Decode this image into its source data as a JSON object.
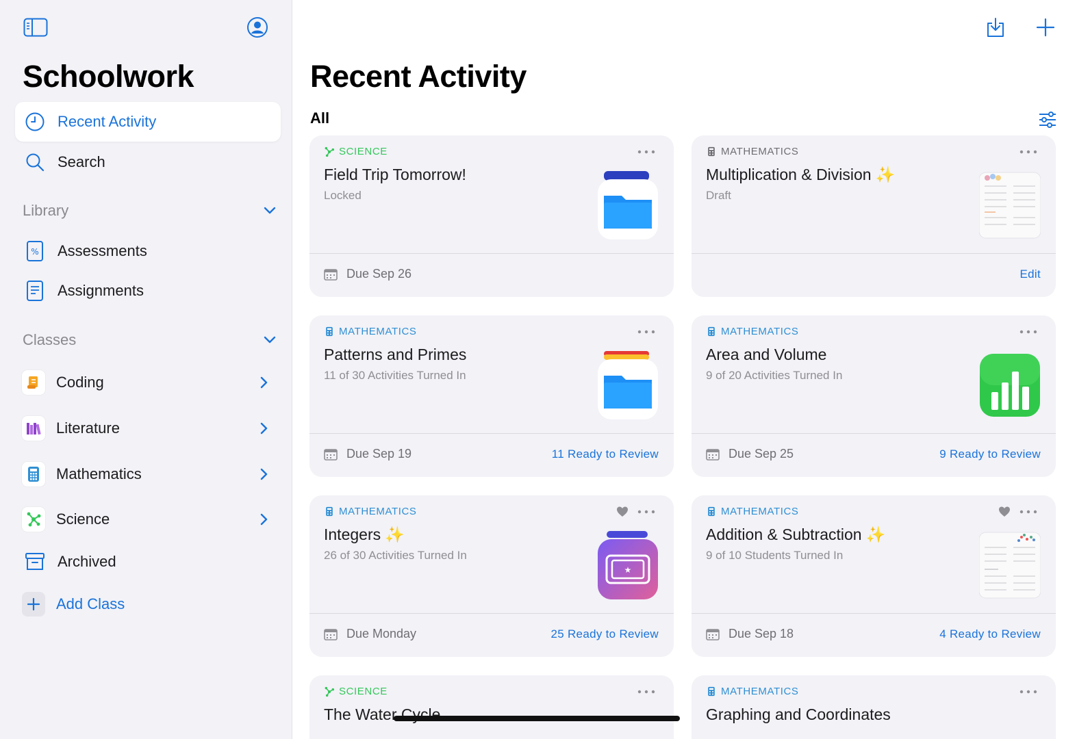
{
  "sidebar": {
    "title": "Schoolwork",
    "nav": [
      {
        "label": "Recent Activity",
        "icon": "clock-icon"
      },
      {
        "label": "Search",
        "icon": "magnifier-icon"
      }
    ],
    "library": {
      "header": "Library",
      "items": [
        {
          "label": "Assessments",
          "icon": "percent-doc-icon"
        },
        {
          "label": "Assignments",
          "icon": "doc-icon"
        }
      ]
    },
    "classes": {
      "header": "Classes",
      "items": [
        {
          "label": "Coding",
          "icon": "scroll-icon"
        },
        {
          "label": "Literature",
          "icon": "books-icon"
        },
        {
          "label": "Mathematics",
          "icon": "calculator-icon"
        },
        {
          "label": "Science",
          "icon": "molecule-icon"
        }
      ]
    },
    "archived": "Archived",
    "add_class": "Add Class"
  },
  "main": {
    "title": "Recent Activity",
    "filter": "All",
    "cards": [
      {
        "subject": "SCIENCE",
        "title": "Field Trip Tomorrow!",
        "sparkle": "",
        "subtitle": "Locked",
        "due": "Due Sep 26",
        "action": "",
        "thumb": "files-app-icon"
      },
      {
        "subject": "MATHEMATICS",
        "title": "Multiplication & Division",
        "sparkle": "✨",
        "subtitle": "Draft",
        "due": "",
        "action": "Edit",
        "thumb": "worksheet-thumbnail"
      },
      {
        "subject": "MATHEMATICS",
        "title": "Patterns and Primes",
        "sparkle": "",
        "subtitle": "11 of 30 Activities Turned In",
        "due": "Due Sep 19",
        "action": "11 Ready to Review",
        "thumb": "files-app-icon"
      },
      {
        "subject": "MATHEMATICS",
        "title": "Area and Volume",
        "sparkle": "",
        "subtitle": "9 of 20 Activities Turned In",
        "due": "Due Sep 25",
        "action": "9 Ready to Review",
        "thumb": "numbers-app-icon"
      },
      {
        "subject": "MATHEMATICS",
        "title": "Integers",
        "sparkle": "✨",
        "subtitle": "26 of 30 Activities Turned In",
        "due": "Due Monday",
        "action": "25 Ready to Review",
        "thumb": "activity-app-icon"
      },
      {
        "subject": "MATHEMATICS",
        "title": "Addition & Subtraction",
        "sparkle": "✨",
        "subtitle": "9 of 10 Students Turned In",
        "due": "Due Sep 18",
        "action": "4 Ready to Review",
        "thumb": "worksheet-thumbnail"
      },
      {
        "subject": "SCIENCE",
        "title": "The Water Cycle",
        "sparkle": "",
        "subtitle": "",
        "due": "",
        "action": "",
        "thumb": ""
      },
      {
        "subject": "MATHEMATICS",
        "title": "Graphing and Coordinates",
        "sparkle": "",
        "subtitle": "",
        "due": "",
        "action": "",
        "thumb": ""
      }
    ]
  },
  "colors": {
    "accent": "#1a73d9",
    "science": "#34c759",
    "mathematics": "#2f8fd3",
    "sidebar_bg": "#f2f2f7"
  }
}
